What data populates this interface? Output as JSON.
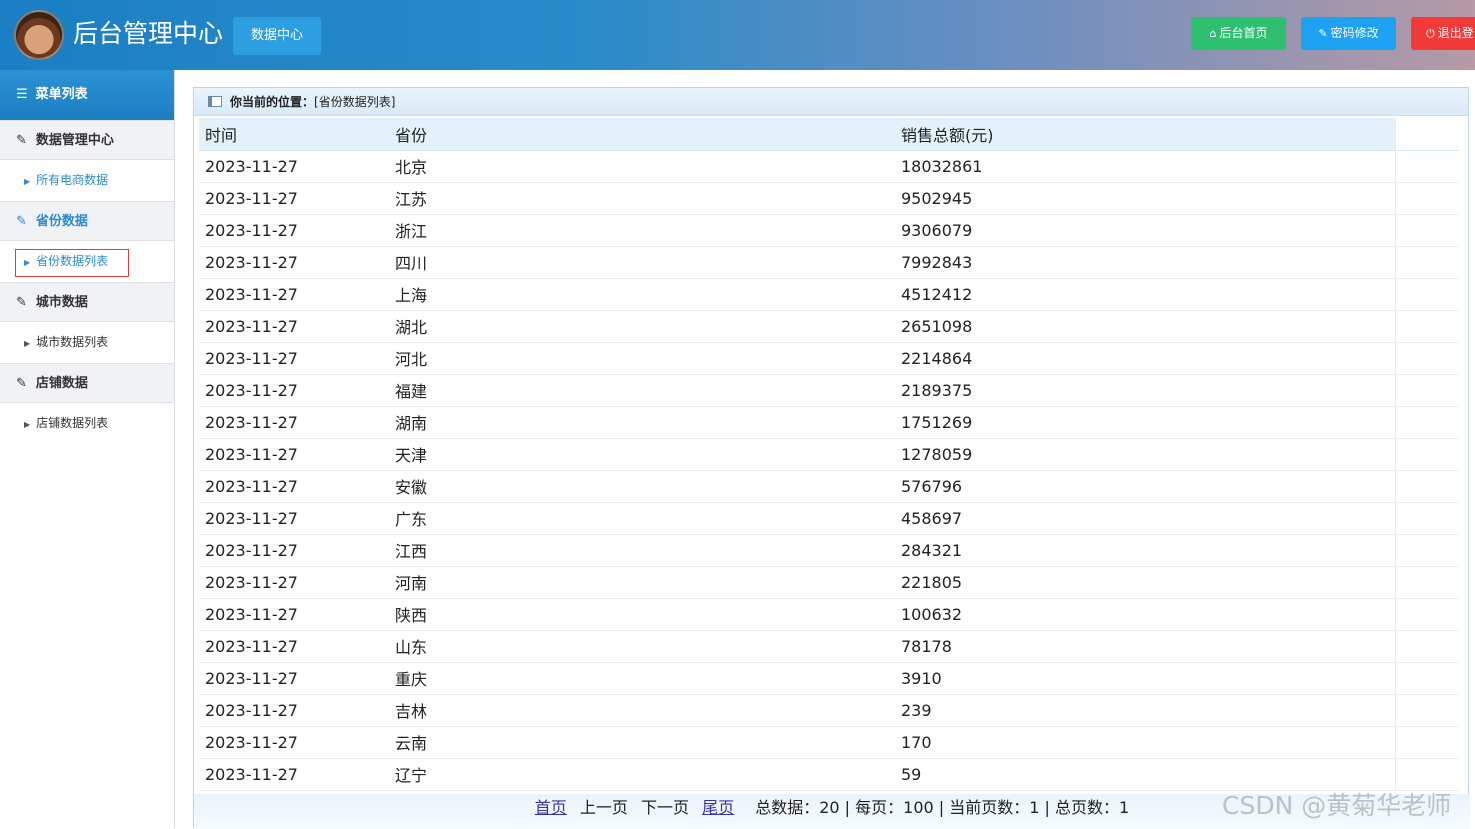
{
  "header": {
    "title": "后台管理中心",
    "data_center": "数据中心",
    "home_label": "后台首页",
    "password_label": "密码修改",
    "logout_label": "退出登录"
  },
  "sidebar": {
    "title": "菜单列表",
    "groups": [
      {
        "label": "数据管理中心",
        "items": [
          {
            "label": "所有电商数据"
          }
        ]
      },
      {
        "label": "省份数据",
        "items": [
          {
            "label": "省份数据列表"
          }
        ]
      },
      {
        "label": "城市数据",
        "items": [
          {
            "label": "城市数据列表"
          }
        ]
      },
      {
        "label": "店铺数据",
        "items": [
          {
            "label": "店铺数据列表"
          }
        ]
      }
    ]
  },
  "breadcrumb": {
    "prefix": "你当前的位置：",
    "location": "[省份数据列表]"
  },
  "table": {
    "headers": [
      "时间",
      "省份",
      "销售总额(元)"
    ],
    "rows": [
      [
        "2023-11-27",
        "北京",
        "18032861"
      ],
      [
        "2023-11-27",
        "江苏",
        "9502945"
      ],
      [
        "2023-11-27",
        "浙江",
        "9306079"
      ],
      [
        "2023-11-27",
        "四川",
        "7992843"
      ],
      [
        "2023-11-27",
        "上海",
        "4512412"
      ],
      [
        "2023-11-27",
        "湖北",
        "2651098"
      ],
      [
        "2023-11-27",
        "河北",
        "2214864"
      ],
      [
        "2023-11-27",
        "福建",
        "2189375"
      ],
      [
        "2023-11-27",
        "湖南",
        "1751269"
      ],
      [
        "2023-11-27",
        "天津",
        "1278059"
      ],
      [
        "2023-11-27",
        "安徽",
        "576796"
      ],
      [
        "2023-11-27",
        "广东",
        "458697"
      ],
      [
        "2023-11-27",
        "江西",
        "284321"
      ],
      [
        "2023-11-27",
        "河南",
        "221805"
      ],
      [
        "2023-11-27",
        "陕西",
        "100632"
      ],
      [
        "2023-11-27",
        "山东",
        "78178"
      ],
      [
        "2023-11-27",
        "重庆",
        "3910"
      ],
      [
        "2023-11-27",
        "吉林",
        "239"
      ],
      [
        "2023-11-27",
        "云南",
        "170"
      ],
      [
        "2023-11-27",
        "辽宁",
        "59"
      ]
    ]
  },
  "pager": {
    "first": "首页",
    "prev": "上一页",
    "next": "下一页",
    "last": "尾页",
    "summary": "总数据：20 | 每页：100 | 当前页数：1 | 总页数：1"
  },
  "watermark": "CSDN @黄菊华老师"
}
